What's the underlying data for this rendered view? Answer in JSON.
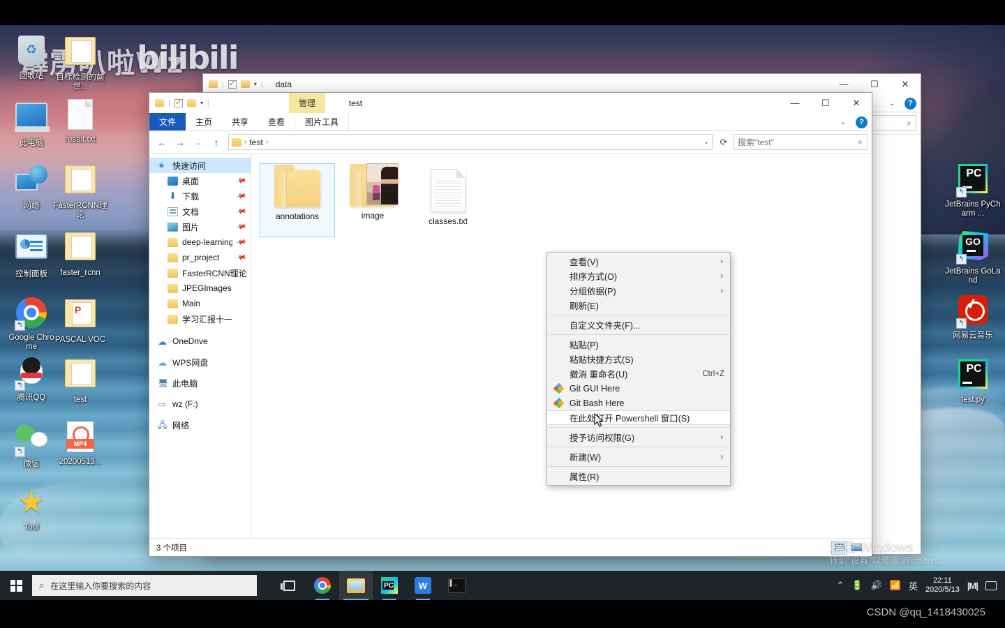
{
  "desktop": {
    "watermark_text": "霹雳叭啦Wz",
    "watermark_brand": "bilibili",
    "icons_left": [
      {
        "label": "回收站",
        "icon": "recycle-bin-icon"
      },
      {
        "label": "目标检测的前世...",
        "icon": "folder-doc-icon"
      },
      {
        "label": "此电脑",
        "icon": "this-pc-icon"
      },
      {
        "label": "result.txt",
        "icon": "text-file-icon"
      },
      {
        "label": "网络",
        "icon": "network-icon"
      },
      {
        "label": "FasterRCNN理论",
        "icon": "folder-doc-icon"
      },
      {
        "label": "控制面板",
        "icon": "control-panel-icon"
      },
      {
        "label": "faster_rcnn",
        "icon": "folder-doc-icon"
      },
      {
        "label": "Google Chrome",
        "icon": "chrome-icon"
      },
      {
        "label": "PASCAL VOC",
        "icon": "folder-ppt-icon"
      },
      {
        "label": "腾讯QQ",
        "icon": "qq-icon"
      },
      {
        "label": "test",
        "icon": "folder-icon"
      },
      {
        "label": "微信",
        "icon": "wechat-icon"
      },
      {
        "label": "20200513...",
        "icon": "mp4-file-icon"
      },
      {
        "label": "Tool",
        "icon": "star-icon"
      }
    ],
    "icons_right": [
      {
        "label": "JetBrains PyCharm ...",
        "icon": "pycharm-icon"
      },
      {
        "label": "JetBrains GoLand",
        "icon": "goland-icon"
      },
      {
        "label": "网易云音乐",
        "icon": "netease-music-icon"
      },
      {
        "label": "test.py",
        "icon": "pycharm-file-icon"
      }
    ]
  },
  "background_window": {
    "title": "data"
  },
  "explorer": {
    "title": "test",
    "contextual_tab": "管理",
    "ribbon_tabs": [
      "文件",
      "主页",
      "共享",
      "查看",
      "图片工具"
    ],
    "address": {
      "crumb_root": "test",
      "sep": "›"
    },
    "search": {
      "placeholder": "搜索\"test\""
    },
    "nav": {
      "quick_access": "快速访问",
      "items": [
        {
          "label": "桌面",
          "icon": "desktop-icon",
          "pinned": true
        },
        {
          "label": "下载",
          "icon": "downloads-icon",
          "pinned": true
        },
        {
          "label": "文档",
          "icon": "documents-icon",
          "pinned": true
        },
        {
          "label": "图片",
          "icon": "pictures-icon",
          "pinned": true
        },
        {
          "label": "deep-learning-",
          "icon": "folder-icon",
          "pinned": true
        },
        {
          "label": "pr_project",
          "icon": "folder-icon",
          "pinned": true
        },
        {
          "label": "FasterRCNN理论",
          "icon": "folder-icon",
          "pinned": false
        },
        {
          "label": "JPEGImages",
          "icon": "folder-icon",
          "pinned": false
        },
        {
          "label": "Main",
          "icon": "folder-icon",
          "pinned": false
        },
        {
          "label": "学习汇报十一",
          "icon": "folder-icon",
          "pinned": false
        }
      ],
      "roots": [
        {
          "label": "OneDrive",
          "icon": "onedrive-icon"
        },
        {
          "label": "WPS网盘",
          "icon": "wps-cloud-icon"
        },
        {
          "label": "此电脑",
          "icon": "this-pc-icon"
        },
        {
          "label": "wz (F:)",
          "icon": "drive-icon"
        },
        {
          "label": "网络",
          "icon": "network-icon"
        }
      ]
    },
    "files": [
      {
        "name": "annotations",
        "type": "folder",
        "selected": true
      },
      {
        "name": "image",
        "type": "folder-photo",
        "selected": false
      },
      {
        "name": "classes.txt",
        "type": "text-file",
        "selected": false
      }
    ],
    "status": "3 个项目"
  },
  "context_menu": {
    "items": [
      {
        "label": "查看(V)",
        "submenu": true
      },
      {
        "label": "排序方式(O)",
        "submenu": true
      },
      {
        "label": "分组依据(P)",
        "submenu": true
      },
      {
        "label": "刷新(E)",
        "submenu": false
      },
      {
        "sep": true
      },
      {
        "label": "自定义文件夹(F)...",
        "submenu": false
      },
      {
        "sep": true
      },
      {
        "label": "粘贴(P)",
        "submenu": false
      },
      {
        "label": "粘贴快捷方式(S)",
        "submenu": false
      },
      {
        "label": "撤消 重命名(U)",
        "submenu": false,
        "accel": "Ctrl+Z"
      },
      {
        "label": "Git GUI Here",
        "submenu": false,
        "icon": "git-icon"
      },
      {
        "label": "Git Bash Here",
        "submenu": false,
        "icon": "git-icon"
      },
      {
        "label": "在此处打开 Powershell 窗口(S)",
        "submenu": false,
        "highlighted": true
      },
      {
        "sep": true
      },
      {
        "label": "授予访问权限(G)",
        "submenu": true
      },
      {
        "sep": true
      },
      {
        "label": "新建(W)",
        "submenu": true
      },
      {
        "sep": true
      },
      {
        "label": "属性(R)",
        "submenu": false
      }
    ]
  },
  "activation_watermark": {
    "line1": "激活 Windows",
    "line2": "转到\"设置\"以激活 Windows。"
  },
  "taskbar": {
    "search_placeholder": "在这里输入你要搜索的内容",
    "buttons": [
      {
        "name": "task-view",
        "label": "任务视图"
      },
      {
        "name": "chrome",
        "label": "Google Chrome"
      },
      {
        "name": "file-explorer",
        "label": "文件资源管理器"
      },
      {
        "name": "pycharm",
        "label": "PyCharm"
      },
      {
        "name": "wps",
        "label": "WPS"
      },
      {
        "name": "terminal",
        "label": "终端"
      }
    ],
    "tray": {
      "ime": "英",
      "time": "22:11",
      "date": "2020/5/13"
    }
  },
  "credit": "CSDN @qq_1418430025",
  "colors": {
    "accent_blue": "#185abd",
    "selection_blue": "#cce8ff",
    "contextual_yellow": "#f5e79e",
    "taskbar": "#1f2429"
  }
}
